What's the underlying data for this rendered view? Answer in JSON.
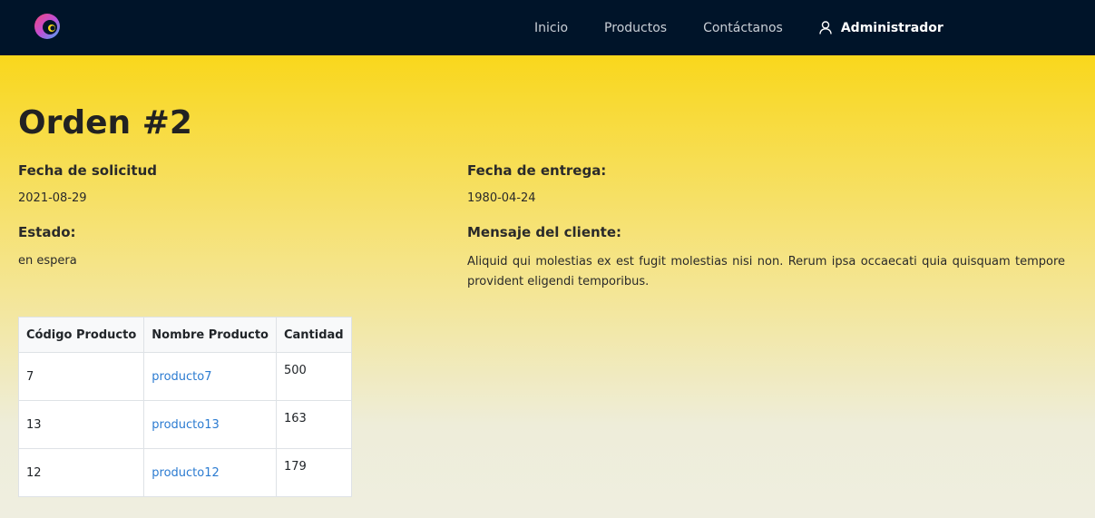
{
  "nav": {
    "logo_icon": "app-logo",
    "links": [
      "Inicio",
      "Productos",
      "Contáctanos"
    ],
    "user_icon": "user-icon",
    "user_label": "Administrador"
  },
  "order": {
    "title": "Orden #2",
    "request_date_label": "Fecha de solicitud",
    "request_date": "2021-08-29",
    "delivery_date_label": "Fecha de entrega:",
    "delivery_date": "1980-04-24",
    "status_label": "Estado:",
    "status": "en espera",
    "message_label": "Mensaje del cliente:",
    "message": "Aliquid qui molestias ex est fugit molestias nisi non. Rerum ipsa occaecati quia quisquam tempore provident eligendi temporibus."
  },
  "table": {
    "headers": [
      "Código Producto",
      "Nombre Producto",
      "Cantidad"
    ],
    "rows": [
      {
        "code": "7",
        "name": "producto7",
        "qty": "500"
      },
      {
        "code": "13",
        "name": "producto13",
        "qty": "163"
      },
      {
        "code": "12",
        "name": "producto12",
        "qty": "179"
      }
    ]
  },
  "colors": {
    "navbar": "#001429",
    "accent_yellow": "#f9d71c",
    "link": "#2b7bd1"
  }
}
